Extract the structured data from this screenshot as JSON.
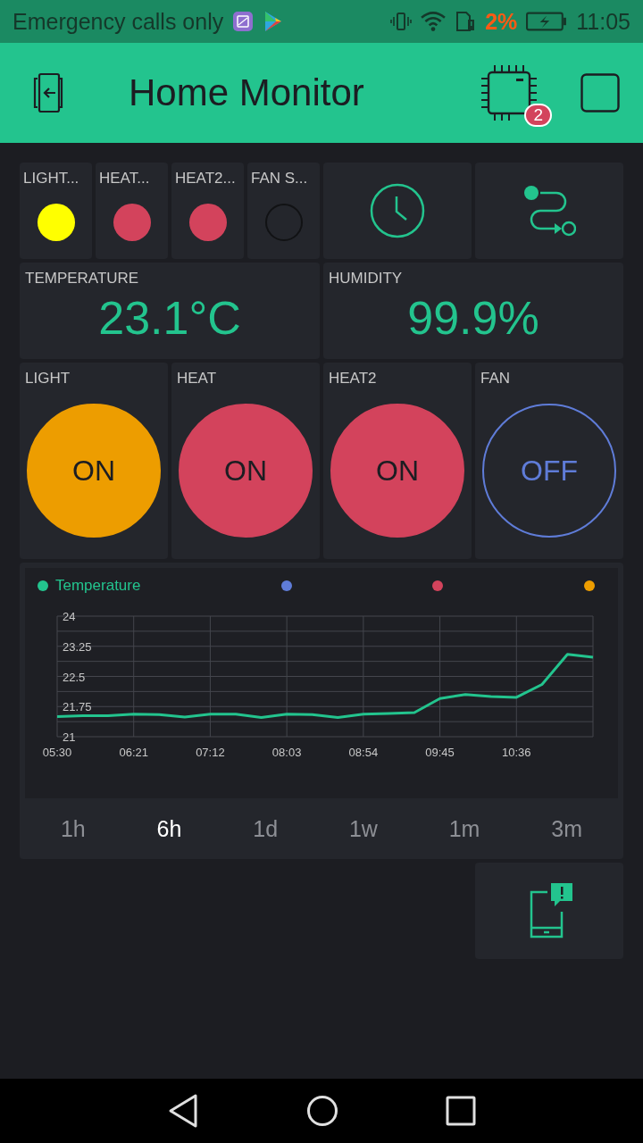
{
  "status_bar": {
    "carrier": "Emergency calls only",
    "battery": "2%",
    "time": "11:05"
  },
  "header": {
    "title": "Home Monitor",
    "badge": "2"
  },
  "leds": [
    {
      "label": "LIGHT...",
      "on": true,
      "color": "#ffff00"
    },
    {
      "label": "HEAT...",
      "on": true,
      "color": "#d3435c"
    },
    {
      "label": "HEAT2...",
      "on": true,
      "color": "#d3435c"
    },
    {
      "label": "FAN S...",
      "on": false
    }
  ],
  "displays": [
    {
      "label": "TEMPERATURE",
      "value": "23.1°C"
    },
    {
      "label": "HUMIDITY",
      "value": "99.9%"
    }
  ],
  "switches": [
    {
      "label": "LIGHT",
      "state": "ON",
      "on": true,
      "color": "#ed9d00"
    },
    {
      "label": "HEAT",
      "state": "ON",
      "on": true,
      "color": "#d3435c"
    },
    {
      "label": "HEAT2",
      "state": "ON",
      "on": true,
      "color": "#d3435c"
    },
    {
      "label": "FAN",
      "state": "OFF",
      "on": false,
      "color": "#5f7cd8"
    }
  ],
  "chart": {
    "legend": [
      {
        "color": "#5f7cd8"
      },
      {
        "color": "#d3435c"
      },
      {
        "color": "#ed9d00"
      }
    ],
    "chart_data": {
      "type": "line",
      "grid": true,
      "ylim": [
        21,
        24
      ],
      "yticks": [
        21,
        21.75,
        22.5,
        23.25,
        24
      ],
      "categories": [
        "05:30",
        null,
        null,
        "06:21",
        null,
        null,
        "07:12",
        null,
        null,
        "08:03",
        null,
        null,
        "08:54",
        null,
        null,
        "09:45",
        null,
        null,
        "10:36",
        null,
        null,
        null
      ],
      "series": [
        {
          "name": "Temperature",
          "color": "#23c48e",
          "values": [
            21.5,
            21.52,
            21.52,
            21.56,
            21.55,
            21.49,
            21.56,
            21.56,
            21.48,
            21.56,
            21.55,
            21.48,
            21.56,
            21.58,
            21.6,
            21.95,
            22.05,
            22.0,
            21.98,
            22.3,
            23.05,
            22.98
          ]
        }
      ]
    },
    "periods": [
      {
        "label": "1h",
        "selected": false
      },
      {
        "label": "6h",
        "selected": true
      },
      {
        "label": "1d",
        "selected": false
      },
      {
        "label": "1w",
        "selected": false
      },
      {
        "label": "1m",
        "selected": false
      },
      {
        "label": "3m",
        "selected": false
      }
    ]
  }
}
